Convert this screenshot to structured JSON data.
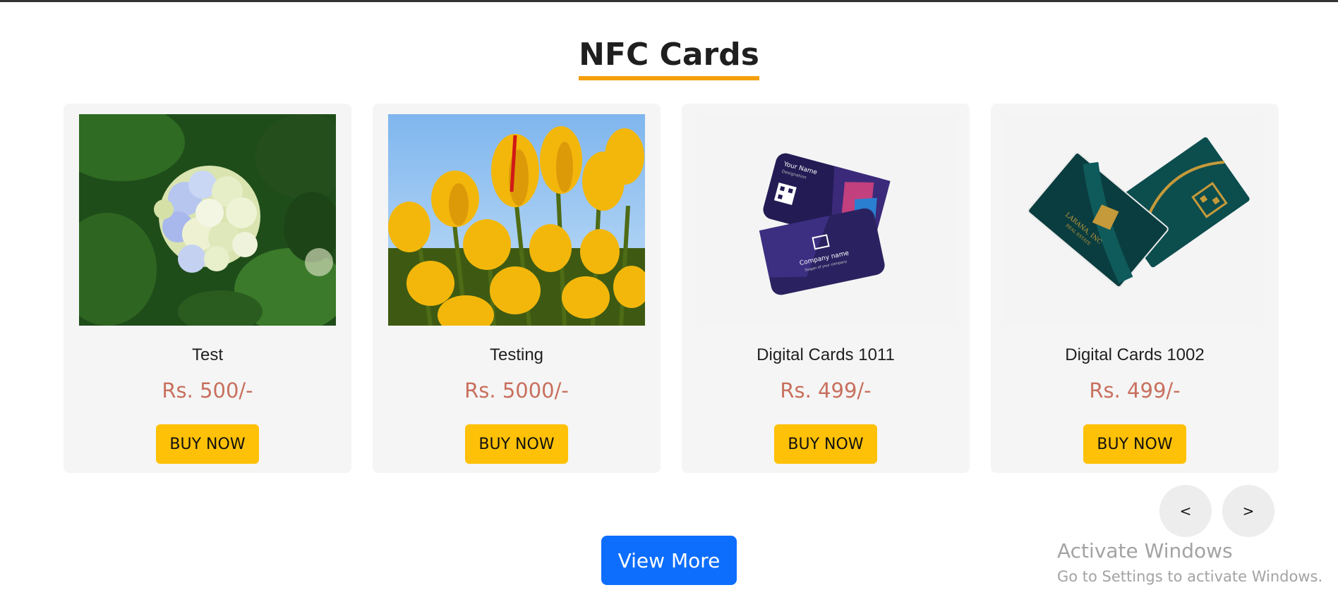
{
  "section": {
    "title": "NFC Cards"
  },
  "products": [
    {
      "name": "Test",
      "price": "Rs. 500/-",
      "buy_label": "BUY NOW",
      "image": "hydrangea-photo"
    },
    {
      "name": "Testing",
      "price": "Rs. 5000/-",
      "buy_label": "BUY NOW",
      "image": "tulips-photo"
    },
    {
      "name": "Digital Cards 1011",
      "price": "Rs. 499/-",
      "buy_label": "BUY NOW",
      "image": "purple-nfc-card",
      "image_text": {
        "name": "Your Name",
        "designation": "Designation",
        "company": "Company name",
        "tagline": "Slogan of your company"
      }
    },
    {
      "name": "Digital Cards 1002",
      "price": "Rs. 499/-",
      "buy_label": "BUY NOW",
      "image": "teal-gold-nfc-card",
      "image_text": {
        "brand": "LARANA, INC",
        "sub": "REAL ESTATE"
      }
    }
  ],
  "carousel": {
    "prev_label": "<",
    "next_label": ">"
  },
  "view_more_label": "View More",
  "watermark": {
    "title": "Activate Windows",
    "subtitle": "Go to Settings to activate Windows."
  },
  "colors": {
    "accent_underline": "#f59e0b",
    "buy_button": "#ffc107",
    "view_more": "#0d6efd",
    "price": "#c8705e",
    "card_bg": "#f5f5f5"
  }
}
